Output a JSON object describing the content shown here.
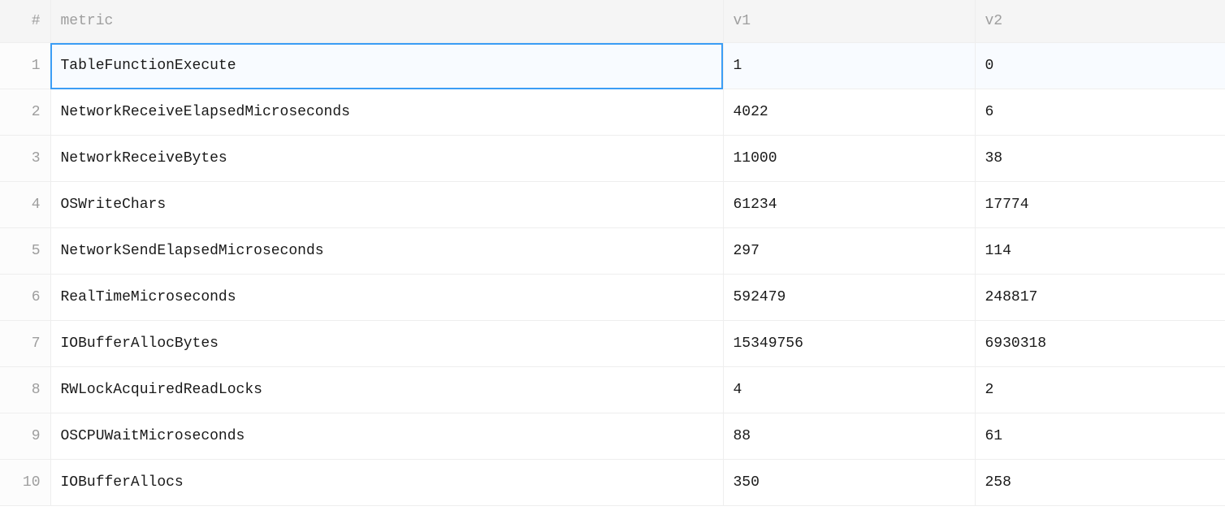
{
  "columns": {
    "row_num": "#",
    "metric": "metric",
    "v1": "v1",
    "v2": "v2"
  },
  "rows": [
    {
      "num": "1",
      "metric": "TableFunctionExecute",
      "v1": "1",
      "v2": "0"
    },
    {
      "num": "2",
      "metric": "NetworkReceiveElapsedMicroseconds",
      "v1": "4022",
      "v2": "6"
    },
    {
      "num": "3",
      "metric": "NetworkReceiveBytes",
      "v1": "11000",
      "v2": "38"
    },
    {
      "num": "4",
      "metric": "OSWriteChars",
      "v1": "61234",
      "v2": "17774"
    },
    {
      "num": "5",
      "metric": "NetworkSendElapsedMicroseconds",
      "v1": "297",
      "v2": "114"
    },
    {
      "num": "6",
      "metric": "RealTimeMicroseconds",
      "v1": "592479",
      "v2": "248817"
    },
    {
      "num": "7",
      "metric": "IOBufferAllocBytes",
      "v1": "15349756",
      "v2": "6930318"
    },
    {
      "num": "8",
      "metric": "RWLockAcquiredReadLocks",
      "v1": "4",
      "v2": "2"
    },
    {
      "num": "9",
      "metric": "OSCPUWaitMicroseconds",
      "v1": "88",
      "v2": "61"
    },
    {
      "num": "10",
      "metric": "IOBufferAllocs",
      "v1": "350",
      "v2": "258"
    }
  ],
  "selected_row_index": 0
}
